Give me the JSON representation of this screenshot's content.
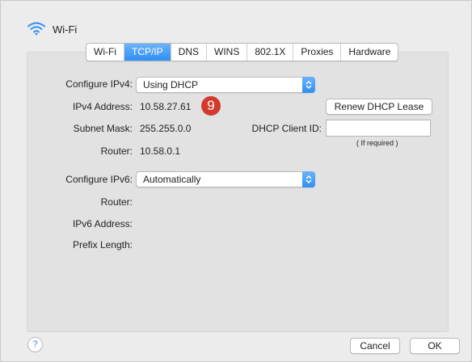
{
  "window": {
    "title": "Wi-Fi",
    "icon": "wifi-icon"
  },
  "tabs": [
    {
      "label": "Wi-Fi"
    },
    {
      "label": "TCP/IP"
    },
    {
      "label": "DNS"
    },
    {
      "label": "WINS"
    },
    {
      "label": "802.1X"
    },
    {
      "label": "Proxies"
    },
    {
      "label": "Hardware"
    }
  ],
  "active_tab": "TCP/IP",
  "ipv4": {
    "configure_label": "Configure IPv4:",
    "configure_value": "Using DHCP",
    "address_label": "IPv4 Address:",
    "address_value": "10.58.27.61",
    "badge": "9",
    "subnet_label": "Subnet Mask:",
    "subnet_value": "255.255.0.0",
    "router_label": "Router:",
    "router_value": "10.58.0.1",
    "renew_button": "Renew DHCP Lease",
    "client_id_label": "DHCP Client ID:",
    "client_id_value": "",
    "client_id_hint": "( If required )"
  },
  "ipv6": {
    "configure_label": "Configure IPv6:",
    "configure_value": "Automatically",
    "router_label": "Router:",
    "address_label": "IPv6 Address:",
    "prefix_label": "Prefix Length:"
  },
  "footer": {
    "help": "?",
    "cancel": "Cancel",
    "ok": "OK"
  },
  "colors": {
    "accent": "#2f8ff3",
    "badge": "#d33a2c"
  }
}
